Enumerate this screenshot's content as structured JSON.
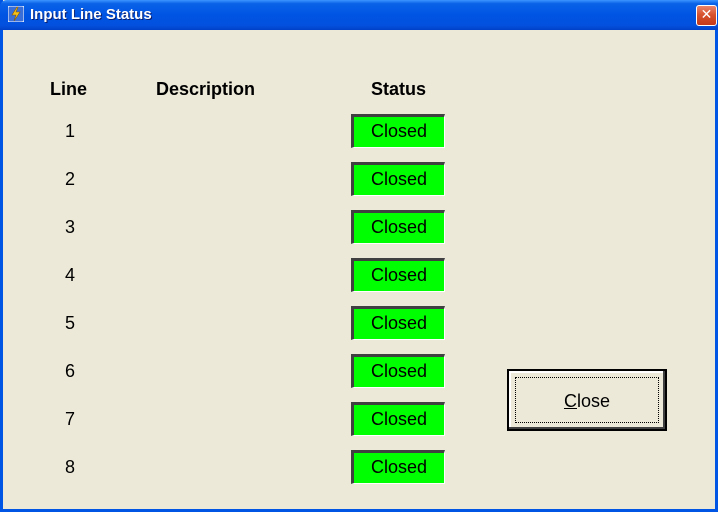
{
  "window": {
    "title": "Input Line Status",
    "close_symbol": "✕"
  },
  "table": {
    "headers": {
      "line": "Line",
      "description": "Description",
      "status": "Status"
    },
    "rows": [
      {
        "line": "1",
        "description": "",
        "status": "Closed"
      },
      {
        "line": "2",
        "description": "",
        "status": "Closed"
      },
      {
        "line": "3",
        "description": "",
        "status": "Closed"
      },
      {
        "line": "4",
        "description": "",
        "status": "Closed"
      },
      {
        "line": "5",
        "description": "",
        "status": "Closed"
      },
      {
        "line": "6",
        "description": "",
        "status": "Closed"
      },
      {
        "line": "7",
        "description": "",
        "status": "Closed"
      },
      {
        "line": "8",
        "description": "",
        "status": "Closed"
      }
    ]
  },
  "buttons": {
    "close_mnemonic": "C",
    "close_rest": "lose"
  },
  "colors": {
    "status_closed": "#00ff00",
    "titlebar": "#0054e3",
    "window_bg": "#ece9d8"
  },
  "icons": {
    "app": "app-lightning-icon",
    "close": "close-icon"
  }
}
